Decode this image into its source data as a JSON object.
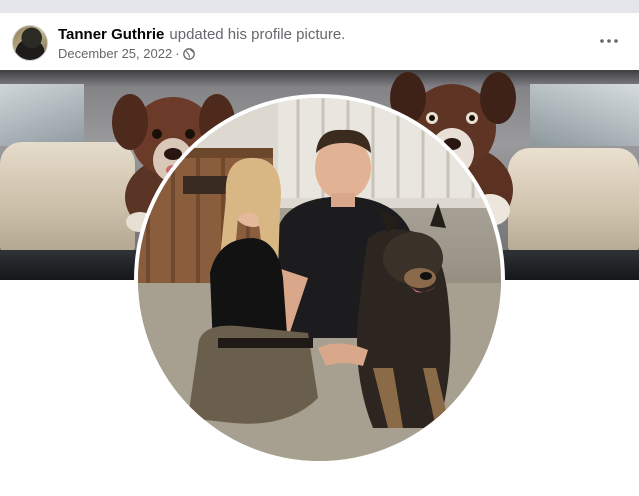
{
  "post": {
    "author": "Tanner Guthrie",
    "action": "updated his profile picture.",
    "date": "December 25, 2022",
    "separator": "·",
    "audience_icon": "globe-icon",
    "more_icon": "more-options-icon"
  },
  "colors": {
    "page_background": "#f0f2f5",
    "card_background": "#ffffff",
    "author_text": "#050505",
    "secondary_text": "#65676b"
  },
  "images": {
    "avatar": "author-avatar",
    "cover": "cover-photo-two-dogs-in-car",
    "profile": "profile-photo-couple-with-german-shepherd"
  }
}
